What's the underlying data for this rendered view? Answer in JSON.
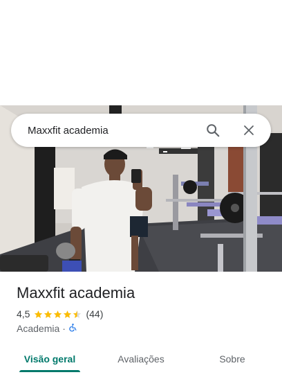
{
  "search": {
    "query": "Maxxfit academia"
  },
  "icons": {
    "search": "search-icon",
    "close": "close-icon",
    "accessibility": "wheelchair-icon",
    "star": "star-icon"
  },
  "place": {
    "name": "Maxxfit academia",
    "rating": "4,5",
    "rating_stars": 4.5,
    "review_count": "(44)",
    "category": "Academia",
    "separator": "·"
  },
  "tabs": [
    {
      "label": "Visão geral",
      "active": true
    },
    {
      "label": "Avaliações",
      "active": false
    },
    {
      "label": "Sobre",
      "active": false
    }
  ],
  "colors": {
    "accent": "#00796b",
    "star": "#fbbc04",
    "accessibility": "#1a73e8"
  }
}
